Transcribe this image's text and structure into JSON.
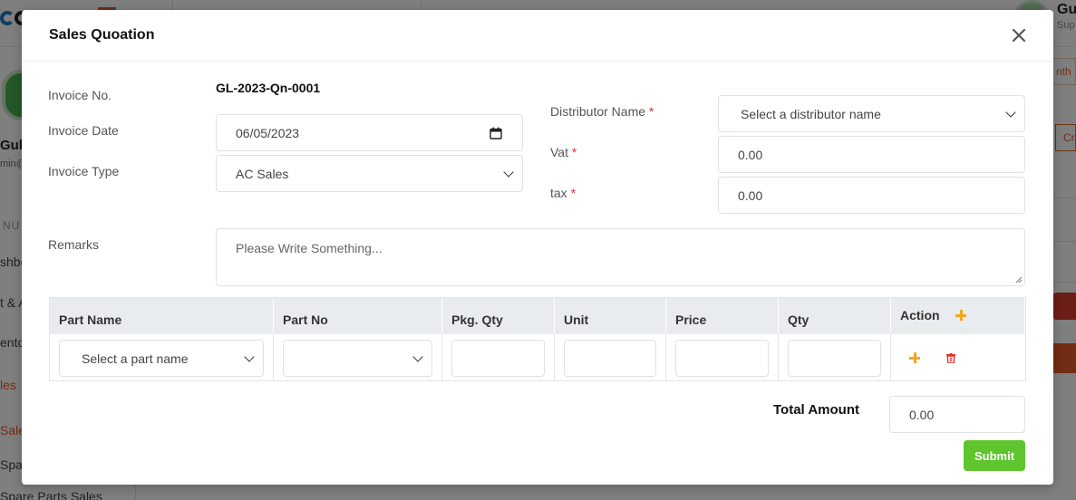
{
  "background": {
    "user_name": "Gu",
    "user_sub": "Sup",
    "sidebar_name": "Gul",
    "sidebar_mail": "min@",
    "menu_label": "NU",
    "items": [
      {
        "label": "shbo",
        "active": false
      },
      {
        "label": "t & A",
        "active": false
      },
      {
        "label": "ento",
        "active": false
      },
      {
        "label": "les",
        "active": true
      },
      {
        "label": "Sale",
        "active": true
      },
      {
        "label": "Spar",
        "active": false
      },
      {
        "label": "Spare Parts Sales",
        "active": false
      }
    ],
    "right_tab": "nth",
    "right_btn": "Cr"
  },
  "modal": {
    "title": "Sales Quoation",
    "close_icon": "close-icon"
  },
  "form": {
    "invoice_no_label": "Invoice No.",
    "invoice_no_value": "GL-2023-Qn-0001",
    "invoice_date_label": "Invoice Date",
    "invoice_date_value": "06/05/2023",
    "invoice_type_label": "Invoice Type",
    "invoice_type_value": "AC Sales",
    "distributor_label": "Distributor Name",
    "distributor_placeholder": "Select a distributor name",
    "vat_label": "Vat",
    "vat_value": "0.00",
    "tax_label": "tax",
    "tax_value": "0.00",
    "required_mark": "*",
    "remarks_label": "Remarks",
    "remarks_placeholder": "Please Write Something..."
  },
  "table": {
    "headers": {
      "part_name": "Part Name",
      "part_no": "Part No",
      "pkg_qty": "Pkg. Qty",
      "unit": "Unit",
      "price": "Price",
      "qty": "Qty",
      "action": "Action"
    },
    "row": {
      "part_name_placeholder": "Select a part name",
      "part_no": "",
      "pkg_qty": "",
      "unit": "",
      "price": "",
      "qty": ""
    }
  },
  "totals": {
    "label": "Total Amount",
    "value": "0.00"
  },
  "submit_label": "Submit",
  "colors": {
    "accent_orange": "#e75a2b",
    "plus_orange": "#f5a623",
    "delete_red": "#e0322a",
    "submit_green": "#5fc52e"
  }
}
